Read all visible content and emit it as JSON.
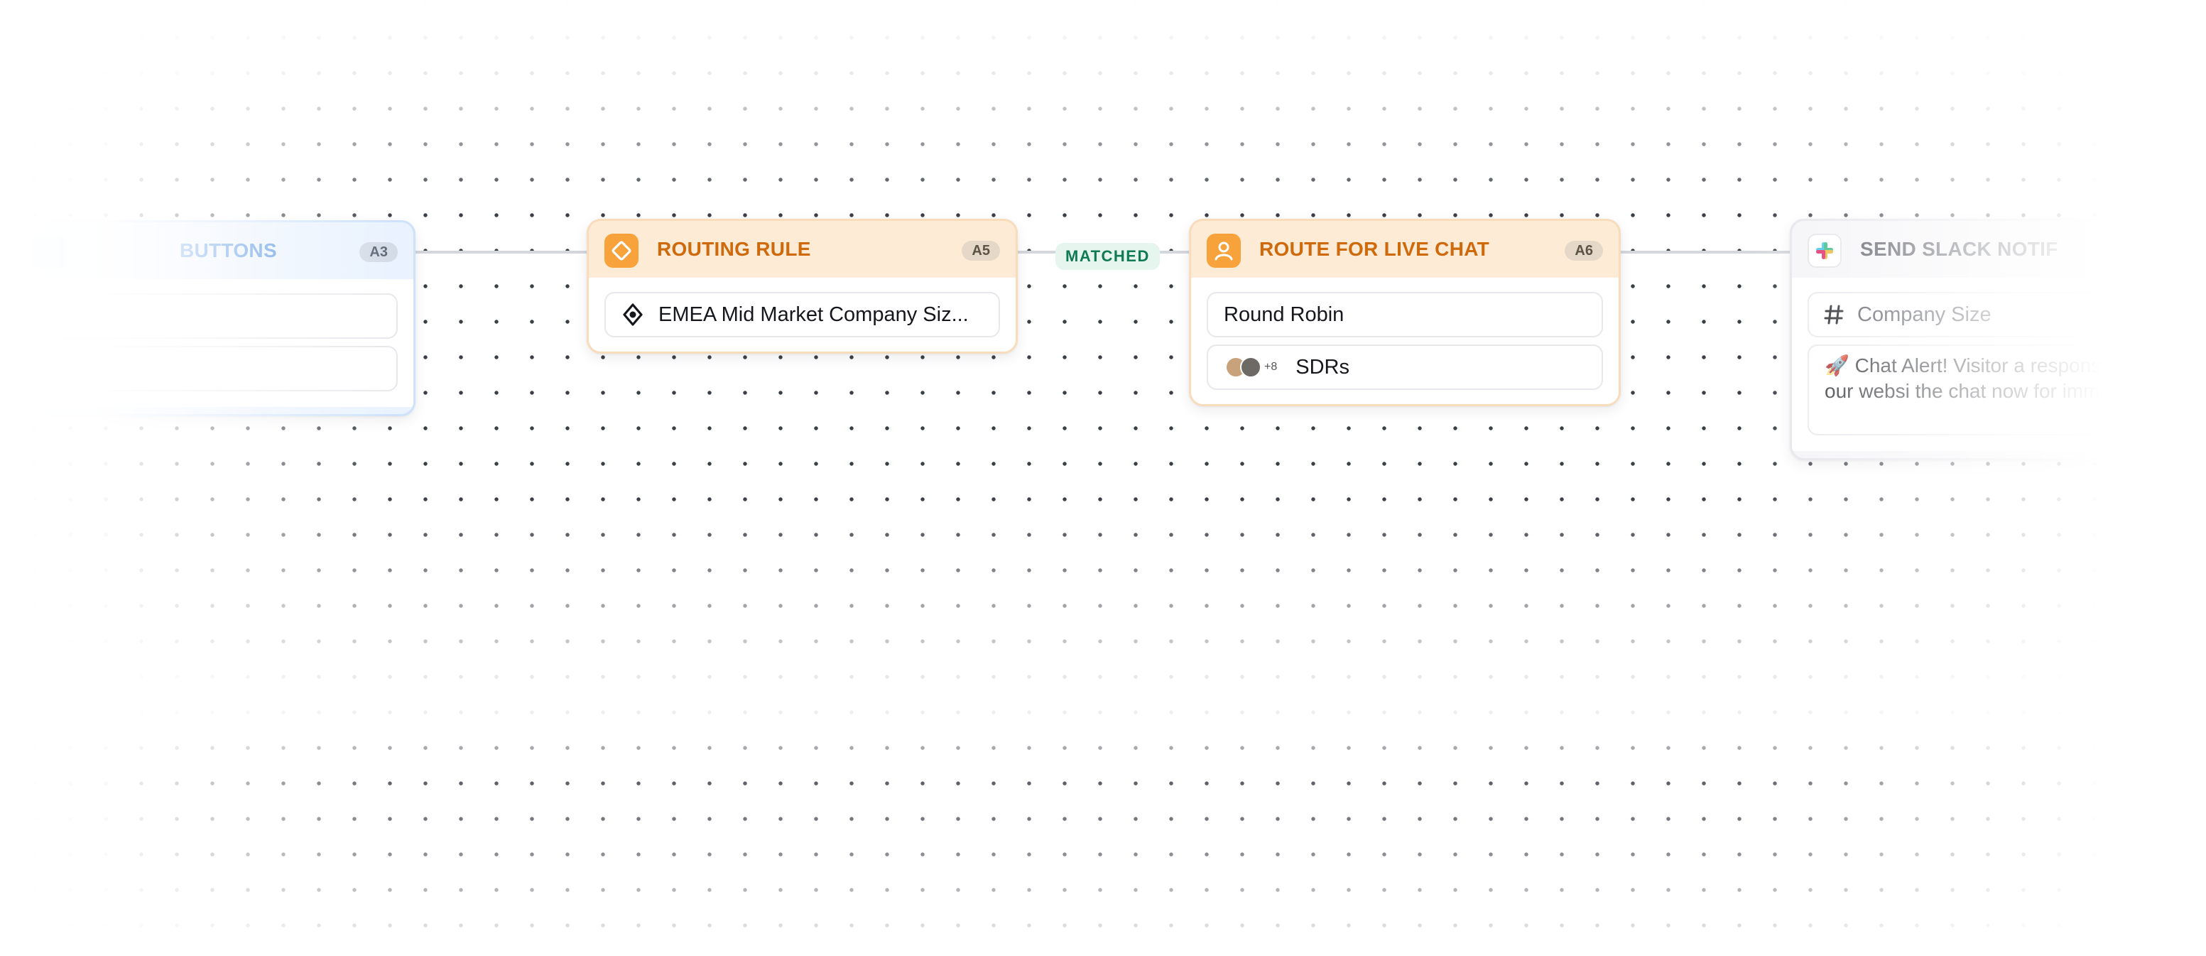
{
  "canvas": {
    "edge_labels": {
      "a5_to_a6": "MATCHED"
    }
  },
  "nodes": {
    "a3": {
      "title": "BUTTONS",
      "id": "A3",
      "accent_color": "#4f8fe0"
    },
    "a5": {
      "title": "ROUTING RULE",
      "id": "A5",
      "icon": "routing-diamond-icon",
      "rule_icon": "branch-diamond-icon",
      "rule_label": "EMEA Mid Market Company Siz...",
      "accent_color": "#f7a23a"
    },
    "a6": {
      "title": "ROUTE FOR LIVE CHAT",
      "id": "A6",
      "icon": "user-icon",
      "method": "Round Robin",
      "team": {
        "extra_count": "+8",
        "name": "SDRs"
      },
      "accent_color": "#f7a23a"
    },
    "slack": {
      "title": "SEND SLACK NOTIF",
      "icon": "slack-icon",
      "channel_icon": "hash-icon",
      "channel": "Company Size",
      "message": "🚀 Chat Alert! Visitor a response on our websi the chat now for immed"
    }
  }
}
